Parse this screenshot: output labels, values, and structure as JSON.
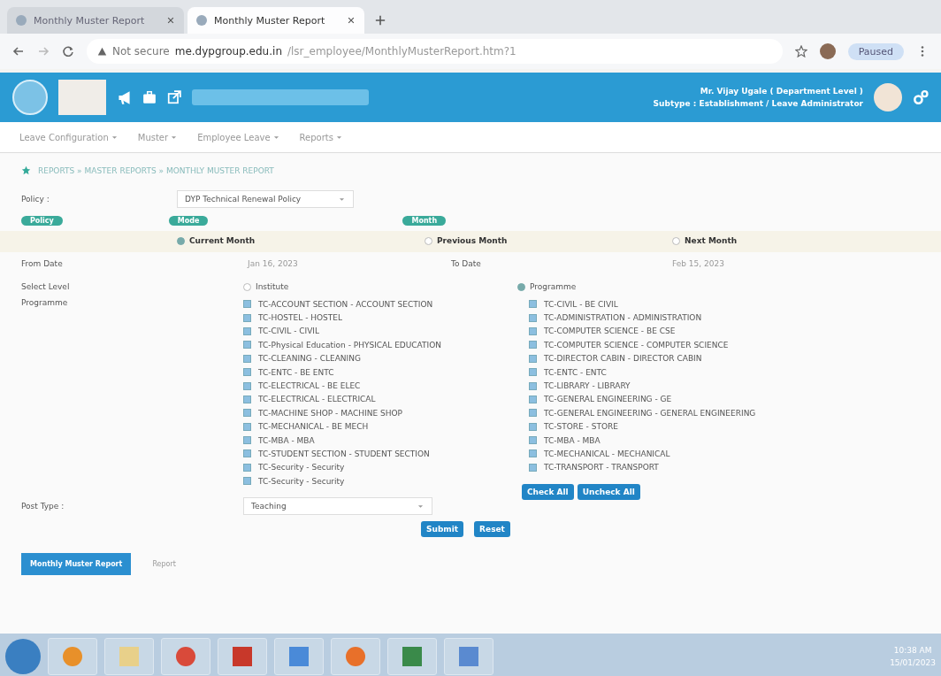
{
  "browser": {
    "tabs": [
      {
        "title": "Monthly Muster Report",
        "selected": false
      },
      {
        "title": "Monthly Muster Report",
        "selected": true
      }
    ],
    "security": "Not secure",
    "url_host": "me.dypgroup.edu.in",
    "url_path": "/lsr_employee/MonthlyMusterReport.htm?1",
    "profile": "Paused"
  },
  "header": {
    "user": "Mr. Vijay Ugale ( Department Level )",
    "role": "Subtype : Establishment / Leave Administrator"
  },
  "menu": [
    {
      "label": "Leave Configuration"
    },
    {
      "label": "Muster"
    },
    {
      "label": "Employee Leave"
    },
    {
      "label": "Reports"
    }
  ],
  "breadcrumb": "REPORTS » MASTER REPORTS » MONTHLY MUSTER REPORT",
  "form": {
    "policy_label": "Policy :",
    "policy_value": "DYP Technical Renewal Policy",
    "badges": [
      "Policy",
      "Mode",
      "Month"
    ],
    "periods": [
      {
        "label": "Current Month",
        "selected": true
      },
      {
        "label": "Previous Month",
        "selected": false
      },
      {
        "label": "Next Month",
        "selected": false
      }
    ],
    "from_label": "From Date",
    "from_value": "Jan 16, 2023",
    "to_label": "To Date",
    "to_value": "Feb 15, 2023",
    "level_label": "Select Level",
    "levels": [
      {
        "label": "Institute",
        "selected": false
      },
      {
        "label": "Programme",
        "selected": true
      }
    ],
    "programme_label": "Programme",
    "programmes_left": [
      {
        "label": "TC-ACCOUNT SECTION - ACCOUNT SECTION",
        "checked": true
      },
      {
        "label": "TC-HOSTEL - HOSTEL",
        "checked": true
      },
      {
        "label": "TC-CIVIL - CIVIL",
        "checked": true
      },
      {
        "label": "TC-Physical Education - PHYSICAL EDUCATION",
        "checked": true
      },
      {
        "label": "TC-CLEANING - CLEANING",
        "checked": true
      },
      {
        "label": "TC-ENTC - BE ENTC",
        "checked": true
      },
      {
        "label": "TC-ELECTRICAL - BE ELEC",
        "checked": true
      },
      {
        "label": "TC-ELECTRICAL - ELECTRICAL",
        "checked": true
      },
      {
        "label": "TC-MACHINE SHOP - MACHINE SHOP",
        "checked": true
      },
      {
        "label": "TC-MECHANICAL - BE MECH",
        "checked": true
      },
      {
        "label": "TC-MBA - MBA",
        "checked": true
      },
      {
        "label": "TC-STUDENT SECTION - STUDENT SECTION",
        "checked": true
      },
      {
        "label": "TC-Security - Security",
        "checked": true
      },
      {
        "label": "TC-Security - Security",
        "checked": true
      }
    ],
    "programmes_right": [
      {
        "label": "TC-CIVIL - BE CIVIL",
        "checked": true
      },
      {
        "label": "TC-ADMINISTRATION - ADMINISTRATION",
        "checked": true
      },
      {
        "label": "TC-COMPUTER SCIENCE - BE CSE",
        "checked": true
      },
      {
        "label": "TC-COMPUTER SCIENCE - COMPUTER SCIENCE",
        "checked": true
      },
      {
        "label": "TC-DIRECTOR CABIN - DIRECTOR CABIN",
        "checked": true
      },
      {
        "label": "TC-ENTC - ENTC",
        "checked": true
      },
      {
        "label": "TC-LIBRARY - LIBRARY",
        "checked": true
      },
      {
        "label": "TC-GENERAL ENGINEERING - GE",
        "checked": true
      },
      {
        "label": "TC-GENERAL ENGINEERING - GENERAL ENGINEERING",
        "checked": true
      },
      {
        "label": "TC-STORE - STORE",
        "checked": true
      },
      {
        "label": "TC-MBA - MBA",
        "checked": true
      },
      {
        "label": "TC-MECHANICAL - MECHANICAL",
        "checked": true
      },
      {
        "label": "TC-TRANSPORT - TRANSPORT",
        "checked": true
      }
    ],
    "check_all": "Check All",
    "uncheck_all": "Uncheck All",
    "post_label": "Post Type :",
    "post_value": "Teaching",
    "submit": "Submit",
    "reset": "Reset"
  },
  "result_tabs": [
    {
      "label": "Monthly Muster Report",
      "selected": true
    },
    {
      "label": "Report",
      "selected": false
    }
  ],
  "taskbar": {
    "time": "10:38 AM",
    "date": "15/01/2023"
  }
}
